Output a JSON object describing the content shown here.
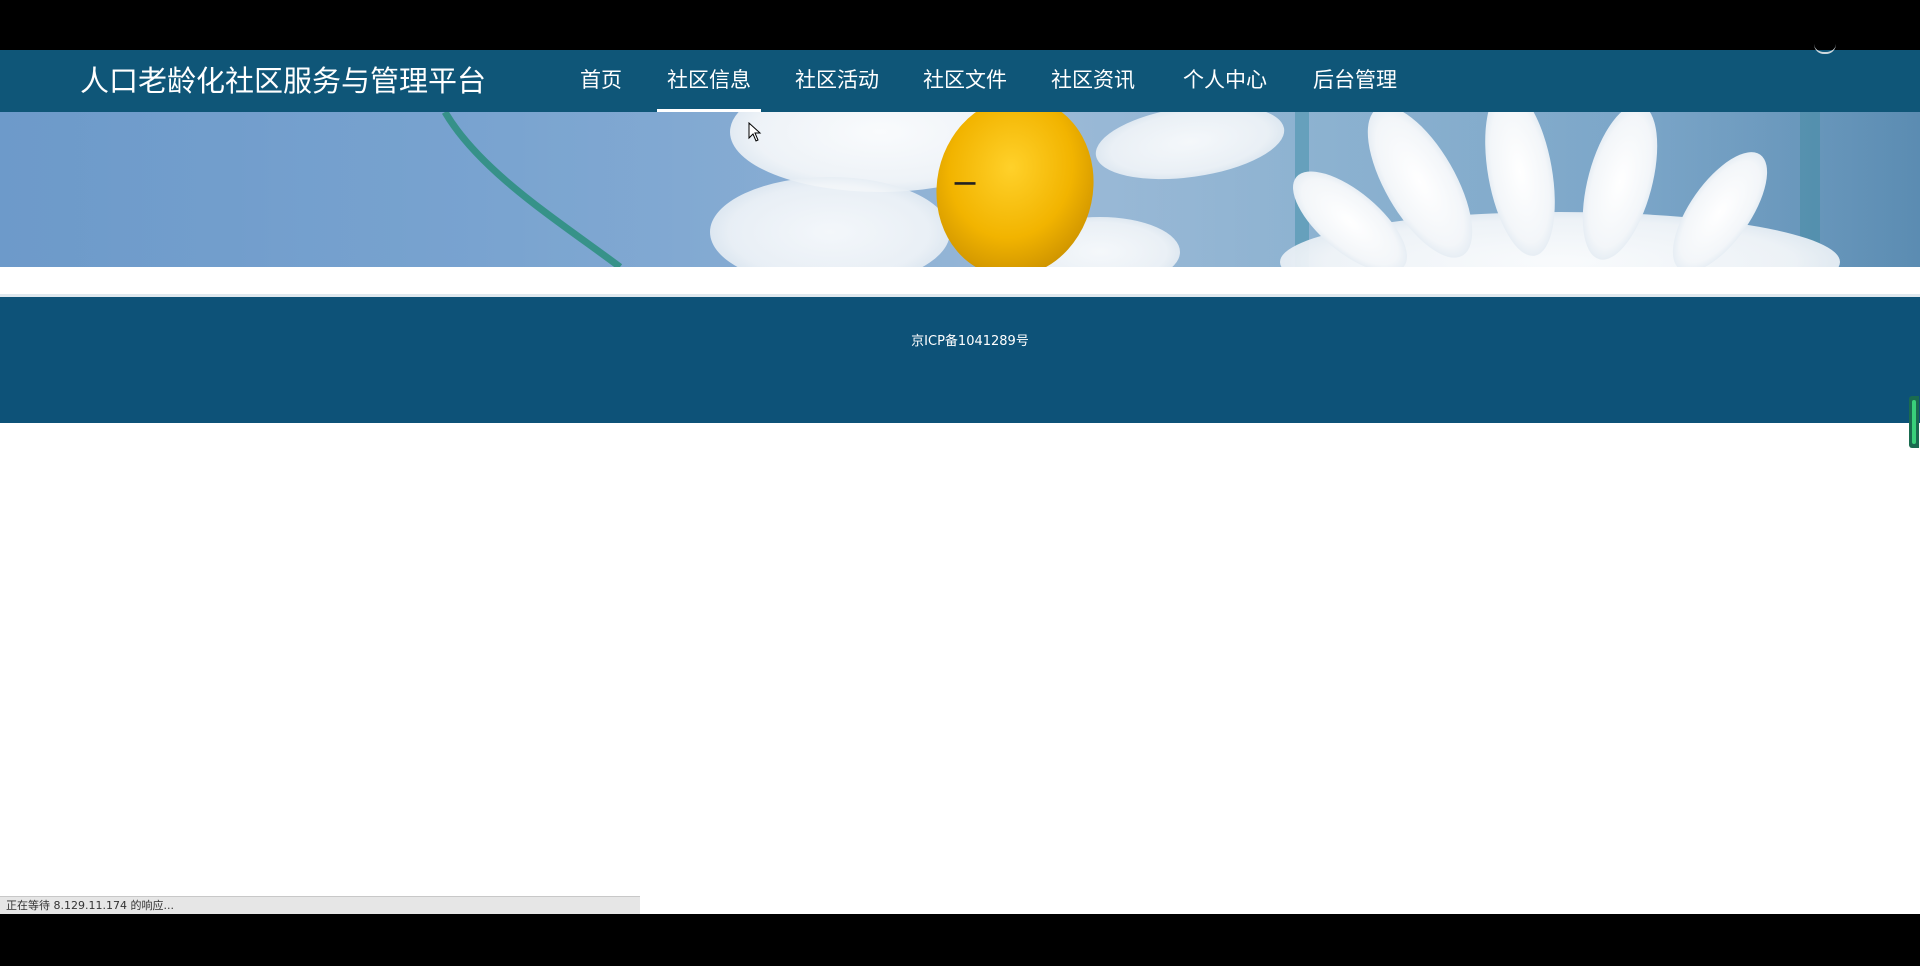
{
  "site": {
    "title": "人口老龄化社区服务与管理平台"
  },
  "nav": {
    "items": [
      {
        "label": "首页"
      },
      {
        "label": "社区信息"
      },
      {
        "label": "社区活动"
      },
      {
        "label": "社区文件"
      },
      {
        "label": "社区资讯"
      },
      {
        "label": "个人中心"
      },
      {
        "label": "后台管理"
      }
    ],
    "active_index": 1
  },
  "banner": {
    "title": "一"
  },
  "footer": {
    "icp": "京ICP备1041289号"
  },
  "status_bar": {
    "text": "正在等待 8.129.11.174 的响应..."
  },
  "colors": {
    "navbar_bg": "#0f5678",
    "footer_bg": "#0d5278",
    "nav_text": "#ffffff"
  }
}
